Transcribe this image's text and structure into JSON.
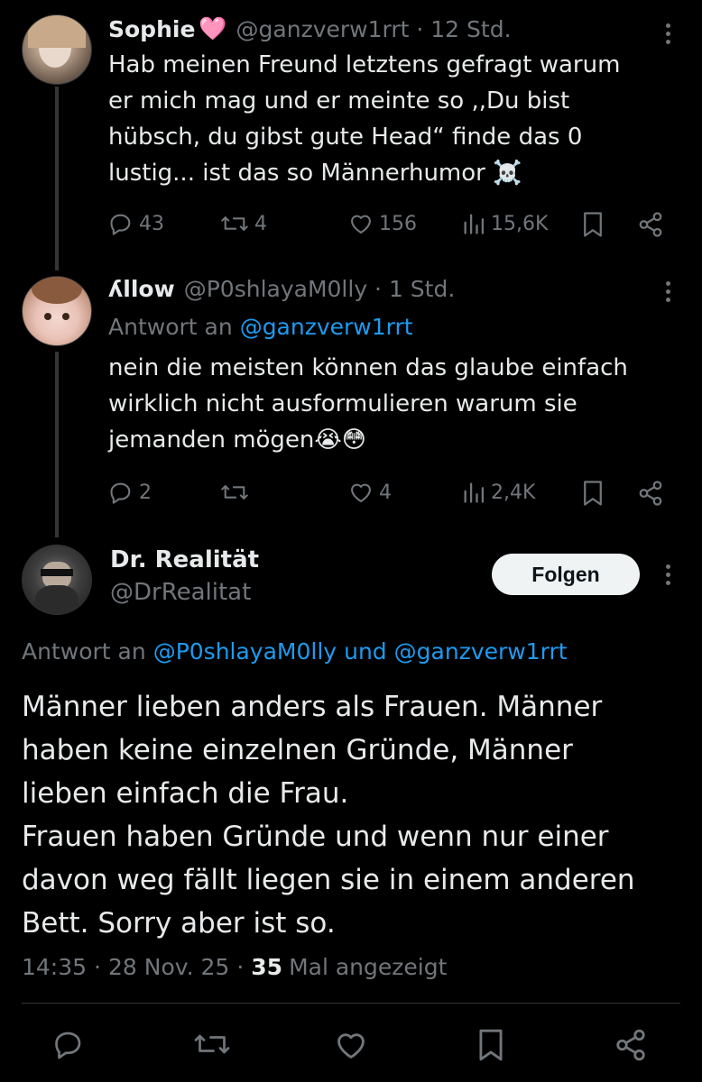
{
  "tweet1": {
    "name": "Sophie",
    "name_emoji": "🩷",
    "handle_time": "@ganzverw1rrt · 12 Std.",
    "text_lines": [
      "Hab meinen Freund letztens gefragt warum",
      "er mich mag und er meinte so ,,Du bist",
      "hübsch, du gibst gute Head“ finde das 0",
      "lustig... ist das so Männerhumor ☠️"
    ],
    "replies": "43",
    "reposts": "4",
    "likes": "156",
    "views": "15,6K"
  },
  "tweet2": {
    "name": "ʎllow",
    "handle_time": "@P0shlayaM0lly · 1 Std.",
    "reply_prefix": "Antwort an",
    "reply_to": "@ganzverw1rrt",
    "text_lines": [
      "nein die meisten können das glaube einfach",
      "wirklich nicht ausformulieren warum sie",
      "jemanden mögen😭😳"
    ],
    "replies": "2",
    "reposts": "",
    "likes": "4",
    "views": "2,4K"
  },
  "tweet3": {
    "name": "Dr. Realität",
    "handle": "@DrRealitat",
    "follow_label": "Folgen",
    "reply_prefix": "Antwort an",
    "reply_to_1": "@P0shlayaM0lly",
    "reply_and": "und",
    "reply_to_2": "@ganzverw1rrt",
    "text_lines": [
      "Männer lieben anders als Frauen. Männer",
      "haben keine einzelnen Gründe, Männer",
      "lieben einfach die Frau.",
      "Frauen haben Gründe und wenn nur einer",
      "davon weg fällt liegen sie in einem anderen",
      "Bett. Sorry aber ist so."
    ],
    "time": "14:35",
    "date": "28 Nov. 25",
    "views_count": "35",
    "views_label": "Mal angezeigt"
  },
  "icons": {
    "reply": "reply-icon",
    "repost": "repost-icon",
    "like": "heart-icon",
    "views": "views-icon",
    "bookmark": "bookmark-icon",
    "share": "share-icon",
    "more": "more-icon"
  },
  "colors": {
    "background": "#000000",
    "text": "#e7e9ea",
    "muted": "#71767b",
    "link": "#1d9bf0",
    "follow_bg": "#eff3f4"
  }
}
